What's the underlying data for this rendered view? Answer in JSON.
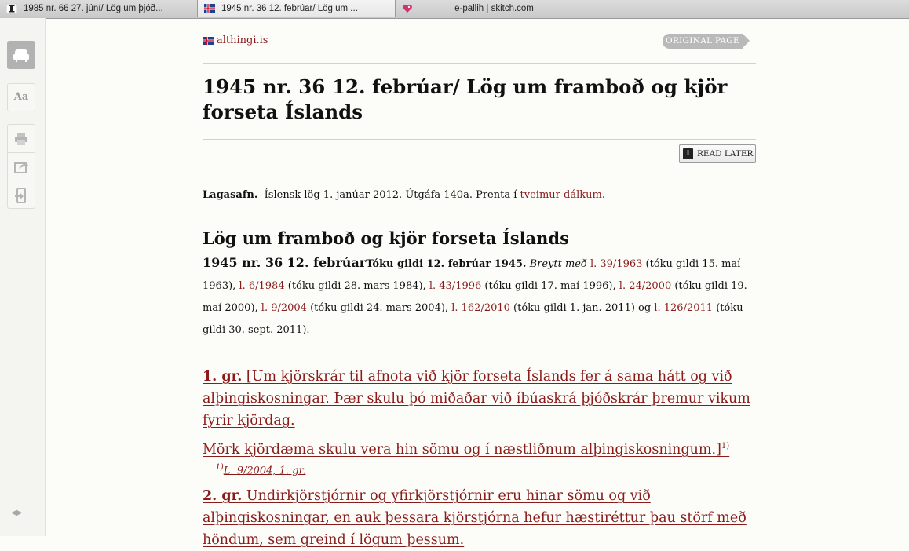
{
  "tabs": [
    {
      "label": "1985 nr. 66 27. júní/ Lög um þjóð...",
      "icon": "instapaper-icon",
      "active": false
    },
    {
      "label": "1945 nr. 36 12. febrúar/ Lög um ...",
      "icon": "iceland-flag-icon",
      "active": true
    },
    {
      "label": "e-pallih | skitch.com",
      "icon": "skitch-heart-icon",
      "active": false
    }
  ],
  "toolbar": {
    "font_label": "Aa",
    "buttons": [
      "reader-chair-icon",
      "font-size-icon",
      "print-icon",
      "share-icon",
      "send-to-device-icon"
    ]
  },
  "article": {
    "site": "althingi.is",
    "original_page": "ORIGINAL PAGE",
    "title": "1945 nr. 36 12. febrúar/ Lög um framboð og kjör forseta Íslands",
    "read_later": "READ LATER",
    "info": {
      "label": "Lagasafn.",
      "text": "Íslensk lög 1. janúar 2012.  Útgáfa 140a.  Prenta í",
      "link": "tveimur dálkum",
      "end": "."
    },
    "law_heading": "Lög um framboð og kjör forseta Íslands",
    "meta": {
      "number": "1945 nr. 36 12. febrúar",
      "effective": "Tóku gildi 12. febrúar 1945.",
      "amended": "Breytt með",
      "amendments": [
        {
          "link": "l. 39/1963",
          "note": "(tóku gildi 15. maí 1963),"
        },
        {
          "link": "l. 6/1984",
          "note": "(tóku gildi 28. mars 1984),"
        },
        {
          "link": "l. 43/1996",
          "note": "(tóku gildi 17. maí 1996),"
        },
        {
          "link": "l. 24/2000",
          "note": "(tóku gildi 19. maí 2000),"
        },
        {
          "link": "l. 9/2004",
          "note": "(tóku gildi 24. mars 2004),"
        },
        {
          "link": "l. 162/2010",
          "note": "(tóku gildi 1. jan. 2011) og"
        },
        {
          "link": "l. 126/2011",
          "note": "(tóku gildi 30. sept. 2011)."
        }
      ]
    },
    "articles": {
      "a1_num": "1. gr.",
      "a1_text": "[Um kjörskrár til afnota við kjör forseta Íslands fer á sama hátt og við alþingiskosningar. Þær skulu þó miðaðar við íbúaskrá þjóðskrár þremur vikum fyrir kjördag.",
      "a1_text2": "Mörk kjördæma skulu vera hin sömu og í næstliðnum alþingiskosningum.]",
      "a1_sup": "1)",
      "fn1_sup": "1)",
      "fn1_text": "L. 9/2004, 1. gr.",
      "a2_num": "2. gr.",
      "a2_text": "Undirkjörstjórnir og yfirkjörstjórnir eru hinar sömu og við alþingiskosningar, en auk þessara kjörstjórna hefur hæstiréttur þau störf með höndum, sem greind í lögum þessum."
    }
  },
  "colors": {
    "link": "#8a1b1b",
    "text": "#111111",
    "page_bg": "#fcfcf8"
  }
}
